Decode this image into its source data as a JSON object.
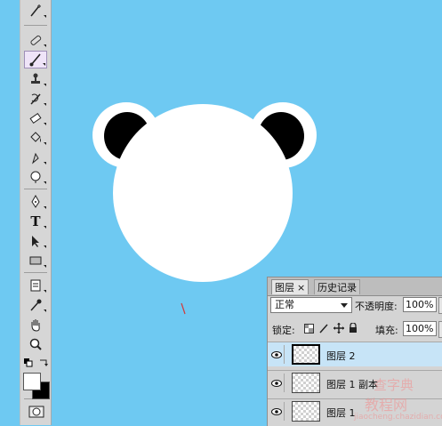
{
  "toolbar": {
    "tools": [
      {
        "name": "magic-wand-icon",
        "selected": false
      },
      {
        "name": "eyedropper-tool-icon",
        "selected": false
      },
      {
        "name": "healing-brush-icon",
        "selected": false
      },
      {
        "name": "brush-icon",
        "selected": true
      },
      {
        "name": "clone-stamp-icon",
        "selected": false
      },
      {
        "name": "history-brush-icon",
        "selected": false
      },
      {
        "name": "eraser-icon",
        "selected": false
      },
      {
        "name": "paint-bucket-icon",
        "selected": false
      },
      {
        "name": "blur-icon",
        "selected": false
      },
      {
        "name": "dodge-icon",
        "selected": false
      },
      {
        "name": "pen-icon",
        "selected": false
      },
      {
        "name": "type-icon",
        "selected": false
      },
      {
        "name": "path-selection-icon",
        "selected": false
      },
      {
        "name": "rectangle-shape-icon",
        "selected": false
      },
      {
        "name": "notes-icon",
        "selected": false
      },
      {
        "name": "eyedropper-icon",
        "selected": false
      },
      {
        "name": "hand-icon",
        "selected": false
      },
      {
        "name": "zoom-icon",
        "selected": false
      }
    ],
    "type_glyph": "T",
    "foreground_color": "#ffffff",
    "background_color": "#000000"
  },
  "canvas": {
    "background_color": "#6ec9f2",
    "shape_color": "#ffffff",
    "ear_inner_color": "#000000"
  },
  "layers_panel": {
    "tabs": [
      "图层",
      "历史记录"
    ],
    "tab_close": "×",
    "blend_mode": "正常",
    "opacity_label": "不透明度:",
    "opacity_value": "100%",
    "lock_label": "锁定:",
    "fill_label": "填充:",
    "fill_value": "100%",
    "layers": [
      {
        "name": "图层 2",
        "selected": true
      },
      {
        "name": "图层 1 副本",
        "selected": false
      },
      {
        "name": "图层 1",
        "selected": false
      }
    ]
  },
  "watermark": {
    "line1": "查字典",
    "line2": "教程网",
    "line3": "jiaocheng.chazidian.com"
  }
}
